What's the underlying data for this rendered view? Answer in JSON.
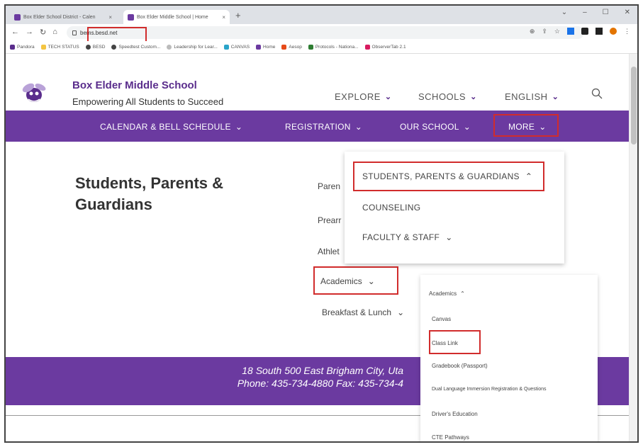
{
  "browser": {
    "tabs": [
      {
        "label": "Box Elder School District - Calen",
        "close": "×"
      },
      {
        "label": "Box Elder Middle School | Home",
        "close": "×"
      }
    ],
    "new_tab": "+",
    "url": "bems.besd.net",
    "bookmarks": [
      "Pandora",
      "TECH STATUS",
      "BESD",
      "Speedtest Custom...",
      "Leadership for Lear...",
      "CANVAS",
      "Home",
      "Aesop",
      "Protocols - Nationa...",
      "ObserverTab 2.1"
    ]
  },
  "header": {
    "school_name": "Box Elder Middle School",
    "tagline": "Empowering All Students to Succeed",
    "top_nav": [
      "EXPLORE",
      "SCHOOLS",
      "ENGLISH"
    ]
  },
  "main_nav": [
    "CALENDAR & BELL SCHEDULE",
    "REGISTRATION",
    "OUR SCHOOL",
    "MORE"
  ],
  "page": {
    "heading": "Students, Parents & Guardians",
    "subnav": [
      "Paren",
      "Prearr",
      "Athlet",
      "Academics",
      "Breakfast & Lunch"
    ]
  },
  "more_menu": {
    "items": [
      "STUDENTS, PARENTS & GUARDIANS",
      "COUNSELING",
      "FACULTY & STAFF"
    ]
  },
  "academics_menu": {
    "title": "Academics",
    "items": [
      "Canvas",
      "Class Link",
      "Gradebook (Passport)",
      "Dual Language Immersion Registration & Questions",
      "Driver's Education",
      "CTE Pathways"
    ]
  },
  "footer": {
    "address_line": "18 South 500 East Brigham City, Uta",
    "phone_line": "Phone: 435-734-4880 Fax: 435-734-4"
  },
  "colors": {
    "brand_purple": "#6b3aa0",
    "highlight_red": "#d12c2c"
  }
}
